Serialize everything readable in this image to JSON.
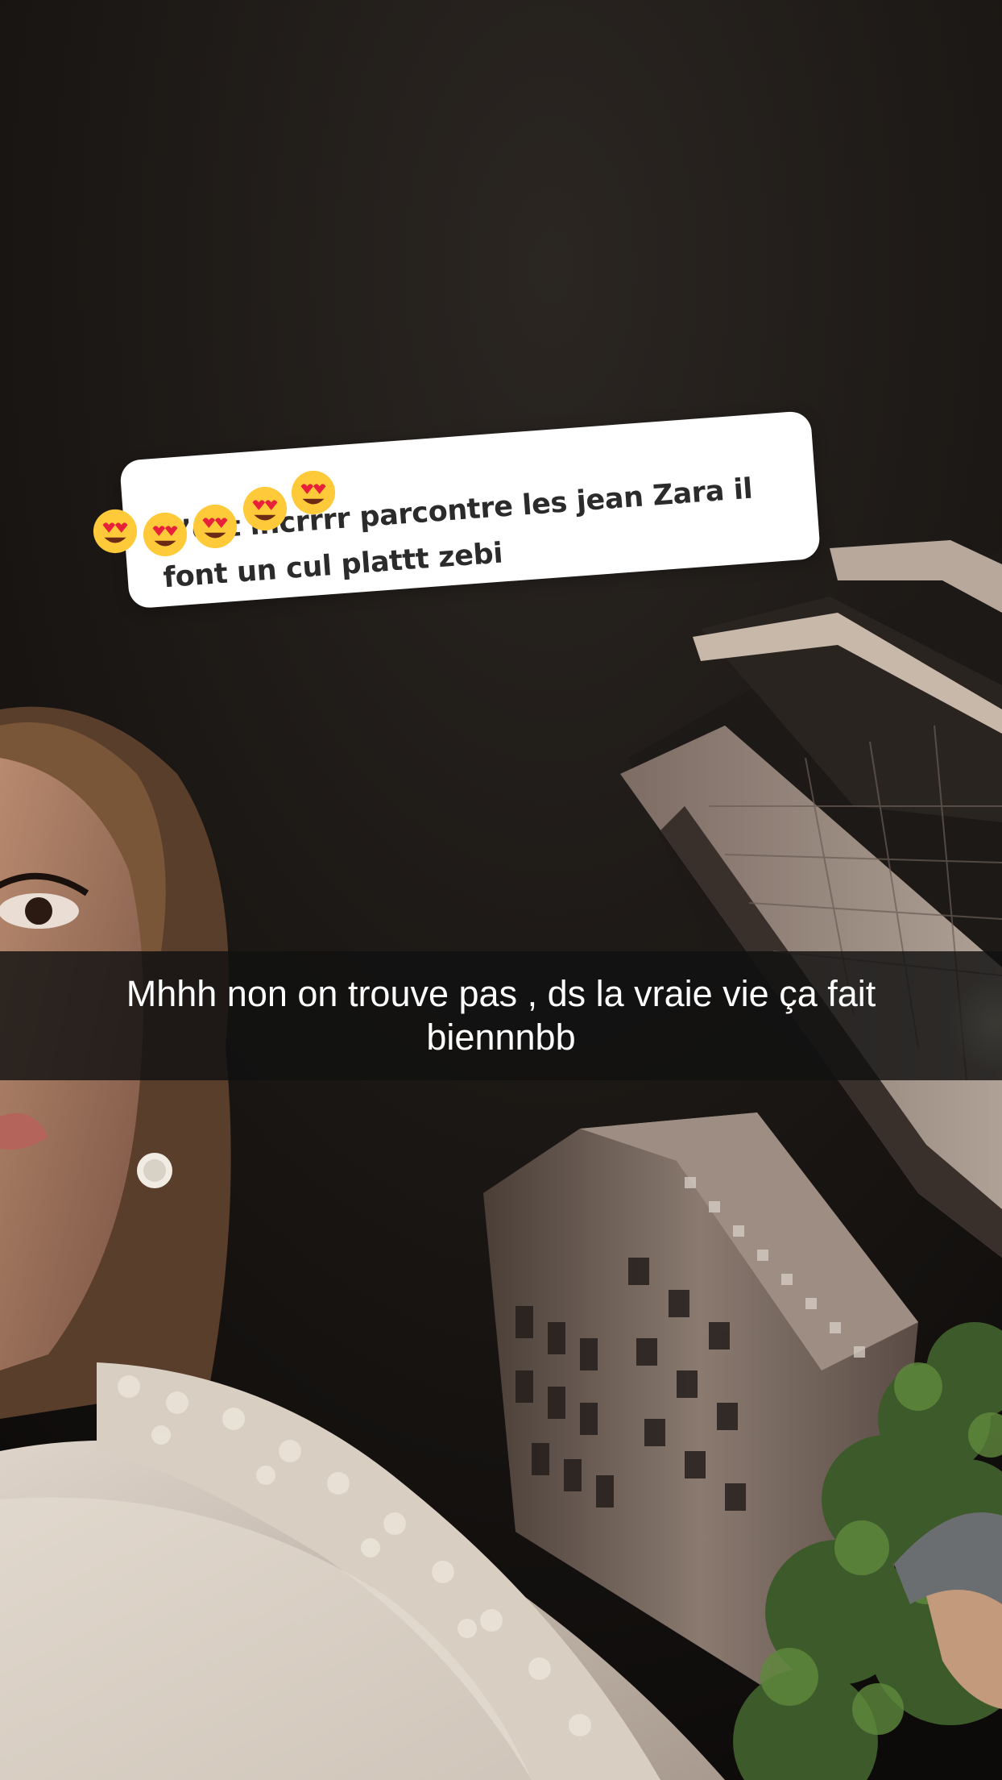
{
  "story": {
    "reply_sticker": {
      "text": "C’est incrrrr parcontre les jean Zara il font un cul plattt zebi",
      "emojis": [
        "heart-eyes-emoji",
        "heart-eyes-emoji",
        "heart-eyes-emoji",
        "heart-eyes-emoji",
        "heart-eyes-emoji"
      ]
    },
    "caption": {
      "text": "Mhhh non on trouve pas , ds la vraie vie ça fait biennnbb"
    }
  },
  "colors": {
    "sticker_bg": "#ffffff",
    "sticker_text": "#2b2b2b",
    "caption_bg": "#111111",
    "caption_text": "#ffffff",
    "emoji_face": "#ffca3a",
    "emoji_heart": "#e8213a"
  }
}
